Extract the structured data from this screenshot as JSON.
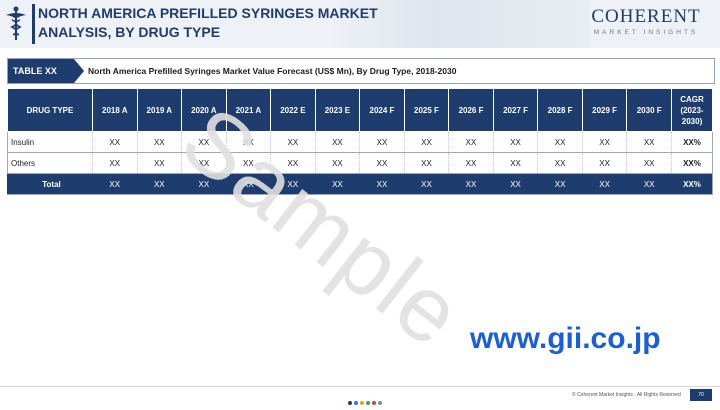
{
  "header": {
    "title": "NORTH AMERICA PREFILLED SYRINGES MARKET ANALYSIS, BY DRUG TYPE",
    "brand_name": "COHERENT",
    "brand_sub": "MARKET INSIGHTS"
  },
  "table_bar": {
    "tag": "TABLE XX",
    "caption": "North America Prefilled Syringes Market Value Forecast (US$ Mn), By Drug Type, 2018-2030"
  },
  "table": {
    "columns": [
      "DRUG TYPE",
      "2018 A",
      "2019 A",
      "2020 A",
      "2021 A",
      "2022 E",
      "2023 E",
      "2024 F",
      "2025 F",
      "2026 F",
      "2027 F",
      "2028 F",
      "2029 F",
      "2030 F",
      "CAGR (2023-2030)"
    ],
    "rows": [
      {
        "name": "Insulin",
        "values": [
          "XX",
          "XX",
          "XX",
          "XX",
          "XX",
          "XX",
          "XX",
          "XX",
          "XX",
          "XX",
          "XX",
          "XX",
          "XX",
          "XX%"
        ]
      },
      {
        "name": "Others",
        "values": [
          "XX",
          "XX",
          "XX",
          "XX",
          "XX",
          "XX",
          "XX",
          "XX",
          "XX",
          "XX",
          "XX",
          "XX",
          "XX",
          "XX%"
        ]
      },
      {
        "name": "Total",
        "values": [
          "XX",
          "XX",
          "XX",
          "XX",
          "XX",
          "XX",
          "XX",
          "XX",
          "XX",
          "XX",
          "XX",
          "XX",
          "XX",
          "XX%"
        ]
      }
    ]
  },
  "watermark": "Sample",
  "gii_watermark": "www.gii.co.jp",
  "footer": {
    "copyright": "© Coherent Market Insights . All Rights Reserved",
    "page": "70",
    "dot_colors": [
      "#1f3c6e",
      "#2e7bd6",
      "#e6a31b",
      "#3aa657",
      "#d6412e",
      "#7b8ca4"
    ]
  },
  "colors": {
    "primary": "#1f3c6e",
    "gii_blue": "#1a5fd8"
  }
}
